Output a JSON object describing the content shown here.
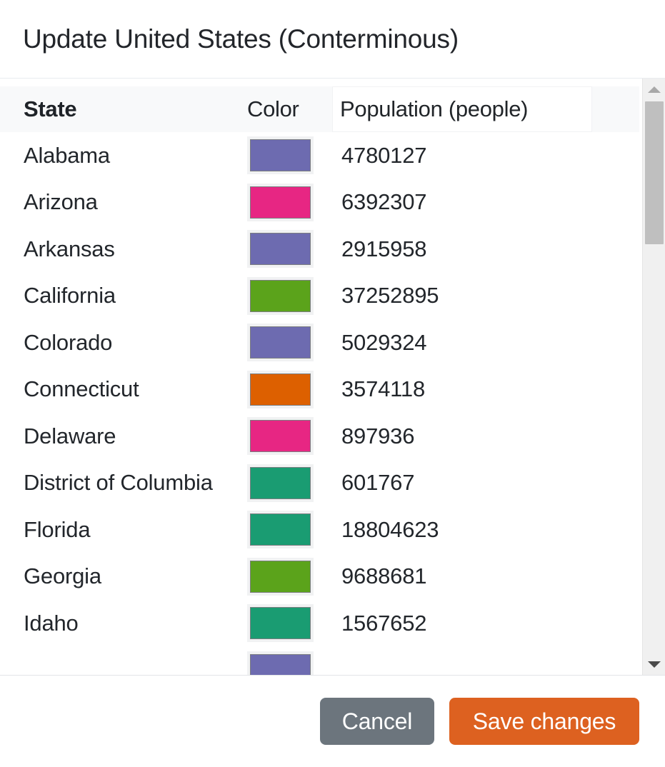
{
  "dialog": {
    "title": "Update United States (Conterminous)"
  },
  "table": {
    "columns": {
      "state": "State",
      "color": "Color",
      "population": "Population (people)"
    },
    "rows": [
      {
        "state": "Alabama",
        "color": "#6d6bb0",
        "population": "4780127"
      },
      {
        "state": "Arizona",
        "color": "#e72683",
        "population": "6392307"
      },
      {
        "state": "Arkansas",
        "color": "#6d6bb0",
        "population": "2915958"
      },
      {
        "state": "California",
        "color": "#5ba31b",
        "population": "37252895"
      },
      {
        "state": "Colorado",
        "color": "#6d6bb0",
        "population": "5029324"
      },
      {
        "state": "Connecticut",
        "color": "#dd6000",
        "population": "3574118"
      },
      {
        "state": "Delaware",
        "color": "#e72683",
        "population": "897936"
      },
      {
        "state": "District of Columbia",
        "color": "#1a9c72",
        "population": "601767"
      },
      {
        "state": "Florida",
        "color": "#1a9c72",
        "population": "18804623"
      },
      {
        "state": "Georgia",
        "color": "#5ba31b",
        "population": "9688681"
      },
      {
        "state": "Idaho",
        "color": "#1a9c72",
        "population": "1567652"
      },
      {
        "state": "",
        "color": "#6d6bb0",
        "population": ""
      }
    ]
  },
  "scrollbar": {
    "up_arrow": "scroll-up",
    "down_arrow": "scroll-down"
  },
  "footer": {
    "cancel_label": "Cancel",
    "save_label": "Save changes"
  },
  "colors": {
    "accent": "#dd6120",
    "cancel": "#6c757d",
    "header_band": "#f8f9fa"
  }
}
